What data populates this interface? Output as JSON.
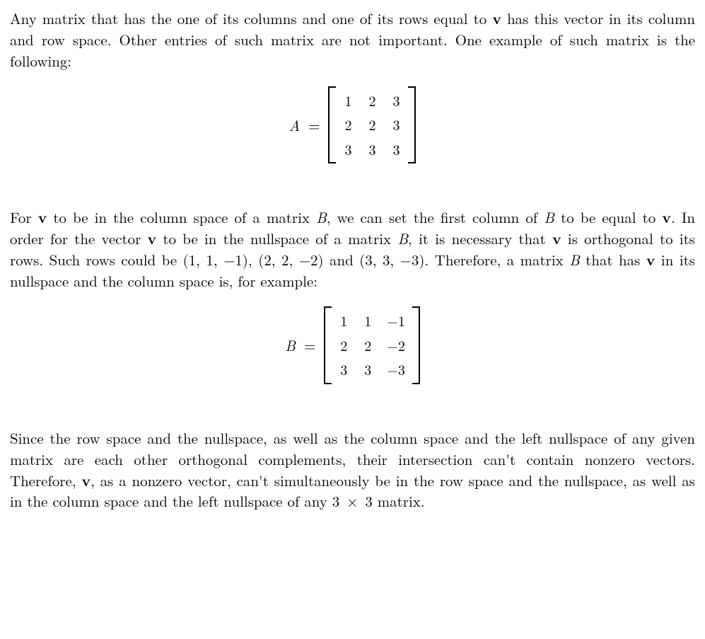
{
  "para1": {
    "t1": "Any matrix that has the one of its columns and one of its rows equal to ",
    "v": "v",
    "t2": " has this vector in its column and row space. Other entries of such matrix are not important. One example of such matrix is the following:"
  },
  "matrixA": {
    "lhs": "A",
    "eq": "=",
    "rows": [
      [
        "1",
        "2",
        "3"
      ],
      [
        "2",
        "2",
        "3"
      ],
      [
        "3",
        "3",
        "3"
      ]
    ]
  },
  "para2": {
    "t1": "For ",
    "v1": "v",
    "t2": " to be in the column space of a matrix ",
    "B1": "B",
    "t3": ", we can set the first column of ",
    "B2": "B",
    "t4": " to be equal to ",
    "v2": "v",
    "t5": ". In order for the vector ",
    "v3": "v",
    "t6": " to be in the nullspace of a matrix ",
    "B3": "B",
    "t7": ", it is necessary that ",
    "v4": "v",
    "t8": " is orthogonal to its rows. Such rows could be (1, 1, −1), (2, 2, −2) and (3, 3, −3). Therefore, a matrix ",
    "B4": "B",
    "t9": " that has ",
    "v5": "v",
    "t10": " in its nullspace and the column space is, for example:"
  },
  "matrixB": {
    "lhs": "B",
    "eq": "=",
    "rows": [
      [
        "1",
        "1",
        "−1"
      ],
      [
        "2",
        "2",
        "−2"
      ],
      [
        "3",
        "3",
        "−3"
      ]
    ]
  },
  "para3": {
    "t1": "Since the row space and the nullspace, as well as the column space and the left nullspace of any given matrix are each other orthogonal complements, their intersection can't contain nonzero vectors. Therefore, ",
    "v": "v",
    "t2": ", as a nonzero vector, can't simultaneously be in the row space and the nullspace, as well as in the column space and the left nullspace of any 3 ",
    "times": "×",
    "t3": " 3 matrix."
  },
  "chart_data": [
    {
      "type": "table",
      "title": "Matrix A",
      "rows": [
        [
          1,
          2,
          3
        ],
        [
          2,
          2,
          3
        ],
        [
          3,
          3,
          3
        ]
      ]
    },
    {
      "type": "table",
      "title": "Matrix B",
      "rows": [
        [
          1,
          1,
          -1
        ],
        [
          2,
          2,
          -2
        ],
        [
          3,
          3,
          -3
        ]
      ]
    }
  ]
}
